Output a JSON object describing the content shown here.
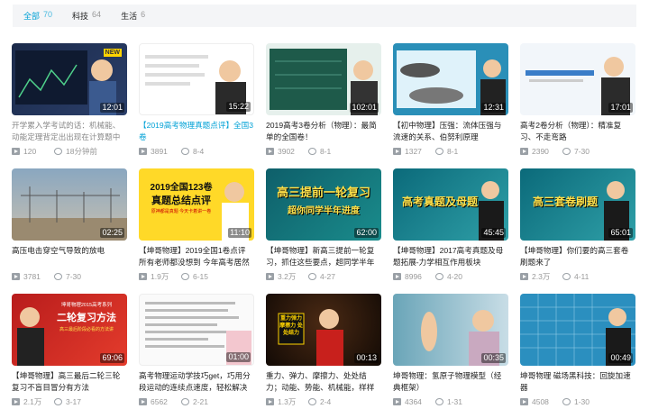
{
  "tabs": [
    {
      "label": "全部",
      "count": "70"
    },
    {
      "label": "科技",
      "count": "64"
    },
    {
      "label": "生活",
      "count": "6"
    }
  ],
  "videos": [
    {
      "duration": "12:01",
      "title": "开学累入学考试的话：机械能、动能定理背定出出现在计算题中的概",
      "views": "120",
      "date": "18分钟前",
      "badge": "NEW"
    },
    {
      "duration": "15:22",
      "title": "【2019高考物理真题点评】全国3卷",
      "views": "3891",
      "date": "8-4"
    },
    {
      "duration": "102:01",
      "title": "2019高考3卷分析（物理）：最简单的全国卷！",
      "views": "3902",
      "date": "8-1"
    },
    {
      "duration": "12:31",
      "title": "【初中物理】压强：流体压强与流速的关系、伯努利原理",
      "views": "1327",
      "date": "8-1"
    },
    {
      "duration": "17:01",
      "title": "高考2卷分析（物理）：精准复习、不走弯路",
      "views": "2390",
      "date": "7-30"
    },
    {
      "duration": "02:25",
      "title": "高压电击穿空气导致的放电",
      "views": "3781",
      "date": "7-30"
    },
    {
      "duration": "11:10",
      "title": "【坤哥物理】2019全国1卷点评 所有老师都没想到 今年高考居然这样",
      "views": "1.9万",
      "date": "6-15",
      "banner1": "2019全国123卷",
      "banner2": "真题总结点评",
      "banner3": "原神都是真题 今天卡着讲一卷"
    },
    {
      "duration": "62:00",
      "title": "【坤哥物理】新高三提前一轮复习，抓住这些要点，超同学半年进",
      "views": "3.2万",
      "date": "4-27",
      "banner1": "高三提前一轮复习",
      "banner2": "超你同学半年进度"
    },
    {
      "duration": "45:45",
      "title": "【坤哥物理】2017高考真题及母题拓展-力学相互作用板块",
      "views": "8996",
      "date": "4-20",
      "banner1": "高考真题及母题"
    },
    {
      "duration": "65:01",
      "title": "【坤哥物理】你们要的高三套卷刷题来了",
      "views": "2.3万",
      "date": "4-11",
      "banner1": "高三套卷刷题"
    },
    {
      "duration": "69:06",
      "title": "【坤哥物理】高三最后二轮三轮复习不盲目冒分有方法",
      "views": "2.1万",
      "date": "3-17",
      "banner0": "坤哥物理2015高考系列",
      "banner1": "二轮复习方法",
      "banner2": "高三最后阶段必看的方法讲"
    },
    {
      "duration": "01:00",
      "title": "高考物理运动学技巧get，巧用分段运动的连续点速度，轻松解决高考",
      "views": "6562",
      "date": "2-21"
    },
    {
      "duration": "00:13",
      "title": "重力、弹力、摩擦力、处处结力；动能、势能、机械能，样样都能！",
      "views": "1.3万",
      "date": "2-4",
      "banner1": "重力弹力 摩擦力 处处结力"
    },
    {
      "duration": "00:35",
      "title": "坤哥物理：氢原子物理模型（经典框架）",
      "views": "4364",
      "date": "1-31"
    },
    {
      "duration": "00:49",
      "title": "坤哥物理 磁场黑科技：回旋加速器",
      "views": "4508",
      "date": "1-30"
    }
  ],
  "colors": {
    "accent": "#00a1d6",
    "title_hl": "#00a1d6"
  }
}
